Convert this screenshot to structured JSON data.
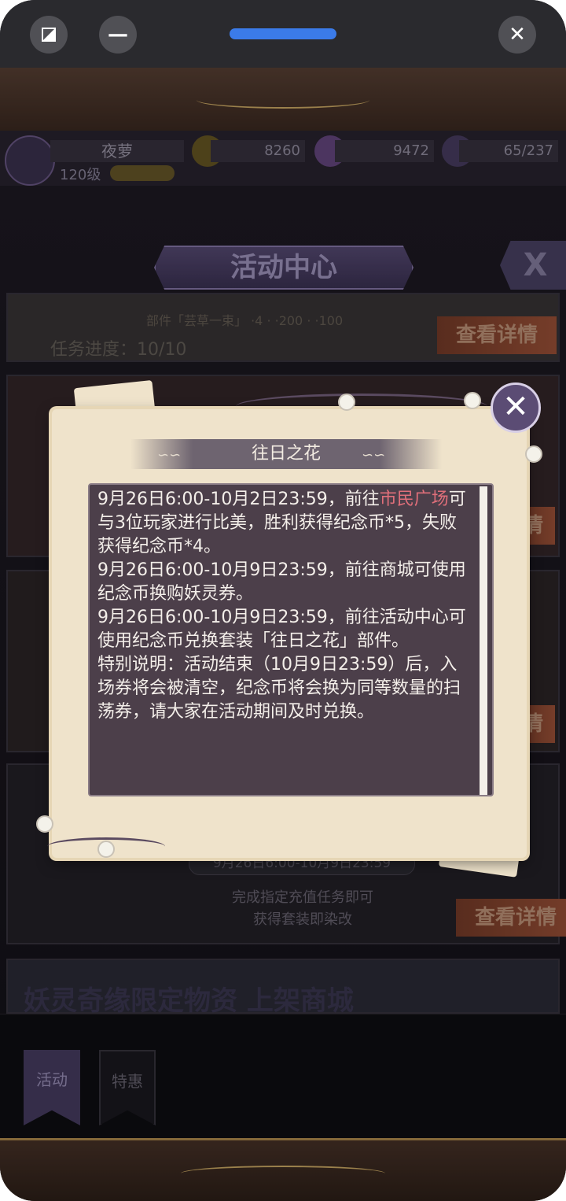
{
  "statusbar": {
    "left_icon": "rotate-icon",
    "minimize_label": "—",
    "close_label": "✕"
  },
  "resources": {
    "player_name": "夜萝",
    "level": "120级",
    "coins": "8260",
    "gems": "9472",
    "stamina": "65/237"
  },
  "header": {
    "title": "活动中心",
    "close_label": "X"
  },
  "cards": {
    "top_reward_line": "部件「芸草一束」 ·4 · ·200 · ·100",
    "progress": "任务进度：10/10",
    "detail_button": "查看详情",
    "detail_partial": "情",
    "date_range": "9月26日6:00-10月9日23:59",
    "condition_line1": "完成指定充值任务即可",
    "condition_line2": "获得套装即染改",
    "shop_banner": "妖灵奇缘限定物资 上架商城"
  },
  "dialog": {
    "title": "往日之花",
    "close_label": "✕",
    "para1_prefix": "9月26日6:00-10月2日23:59，前往",
    "para1_highlight": "市民广场",
    "para1_suffix": "可与3位玩家进行比美，胜利获得纪念币*5，失败获得纪念币*4。",
    "para2": "9月26日6:00-10月9日23:59，前往商城可使用纪念币换购妖灵券。",
    "para3": "9月26日6:00-10月9日23:59，前往活动中心可使用纪念币兑换套装「往日之花」部件。",
    "para4": "特别说明：活动结束（10月9日23:59）后，入场券将会被清空，纪念币将会换为同等数量的扫荡券，请大家在活动期间及时兑换。",
    "highlight_color": "#e06f7a"
  },
  "tabs": [
    {
      "label": "活动"
    },
    {
      "label": "特惠"
    }
  ]
}
